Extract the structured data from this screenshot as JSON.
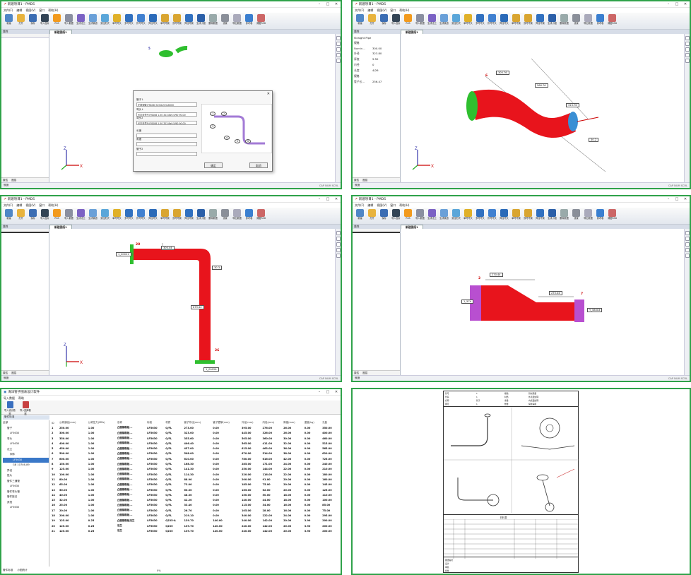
{
  "app": {
    "title": "新建项目1 - PMDS",
    "menu": [
      "文件(F)",
      "编辑",
      "视图(V)",
      "窗口",
      "帮助(H)"
    ],
    "ribbon": [
      {
        "label": "新建",
        "icon": "new-file-icon",
        "color": "#4f86c6"
      },
      {
        "label": "打开",
        "icon": "folder-icon",
        "color": "#e8b33d"
      },
      {
        "label": "保存",
        "icon": "save-icon",
        "color": "#3b6db3"
      },
      {
        "label": "导入图片",
        "icon": "monitor-icon",
        "color": "#345"
      },
      {
        "label": "RSS",
        "icon": "rss-icon",
        "color": "#f29a1d"
      },
      {
        "label": "导入数据",
        "icon": "data-icon",
        "color": "#8a8fa0"
      },
      {
        "label": "生成法兰",
        "icon": "flange-icon",
        "color": "#7b62c4"
      },
      {
        "label": "生成管道",
        "icon": "pipe-icon",
        "color": "#6aa0d8"
      },
      {
        "label": "变径形式",
        "icon": "reducer-icon",
        "color": "#5aa6d9"
      },
      {
        "label": "单弯弯头",
        "icon": "elbow-icon",
        "color": "#e0b028"
      },
      {
        "label": "多弯弯头",
        "icon": "multi-elbow-icon",
        "color": "#3070c0"
      },
      {
        "label": "折弯弯头",
        "icon": "bend-icon",
        "color": "#4080d0"
      },
      {
        "label": "异径弯头",
        "icon": "reduce-elbow-icon",
        "color": "#2a6ab8"
      },
      {
        "label": "单弯弯管",
        "icon": "single-bend-icon",
        "color": "#d9a530"
      },
      {
        "label": "双弯弯管",
        "icon": "double-bend-icon",
        "color": "#d9a530"
      },
      {
        "label": "异径弯管",
        "icon": "reduce-bend-icon",
        "color": "#3070c0"
      },
      {
        "label": "生成小图",
        "icon": "cad-icon",
        "color": "#2b5fa8"
      },
      {
        "label": "删除数据",
        "icon": "delete-icon",
        "color": "#9aa"
      },
      {
        "label": "设置",
        "icon": "tools-icon",
        "color": "#8a8f99"
      },
      {
        "label": "导出数据",
        "icon": "export-icon",
        "color": "#aab"
      },
      {
        "label": "参考卷",
        "icon": "brush-icon",
        "color": "#3a7fd0"
      },
      {
        "label": "调图RSD",
        "icon": "pen-icon",
        "color": "#c66"
      }
    ],
    "side_header": "属性",
    "doc_tab": "新建图纸1",
    "side_tabs": [
      "属性",
      "图层"
    ],
    "status_left": "就绪",
    "status_right": "CAP NUM SCRL",
    "colors": {
      "pipe": "#e8141c",
      "flange_green": "#2fbf2f",
      "flange_purple": "#b84fd0",
      "accent": "#2fa24a"
    }
  },
  "p1": {
    "dialog": {
      "field1_label": "管子↓",
      "field1_value": "无缝钢管(FSK08 323.8x9.5x6000",
      "field2_label": "弯头↓",
      "field2_value": "长半径弯头(FSK08 1.50 323.8x9.5/90 90.00",
      "field3_label": "弯头2",
      "field3_value": "长半径弯头(FSK08 1.50 323.8x9.5/90 90.00",
      "field4_label": "长度",
      "field5_label": "角度",
      "field6_label": "管子2",
      "nodes": [
        "1",
        "2",
        "3",
        "4",
        "5",
        "6"
      ],
      "ok": "确定",
      "cancel": "取消"
    },
    "markers": [
      "5",
      "9"
    ]
  },
  "p2": {
    "prop_title": "Straight Pipe",
    "group1": "规格",
    "rows": [
      {
        "k": "Nomin...",
        "v": "300.00"
      },
      {
        "k": "外径",
        "v": "323.80"
      },
      {
        "k": "厚度",
        "v": "9.50"
      },
      {
        "k": "内径",
        "v": "0"
      },
      {
        "k": "长度",
        "v": "4/26"
      }
    ],
    "group2": "规格",
    "row_last": {
      "k": "管子长...",
      "v": "256.47"
    },
    "labels": [
      "300.76",
      "566.76",
      "313.76",
      "30.2"
    ],
    "marker": "6"
  },
  "p3": {
    "labels": [
      "1_00021",
      "300.44",
      "30.3",
      "679.44",
      "1_00026"
    ],
    "markers": [
      "28",
      "26"
    ]
  },
  "p4": {
    "labels": [
      "270.44",
      "270.44",
      "1_5Ch",
      "Y_58003"
    ],
    "markers": [
      "2",
      "7"
    ]
  },
  "p5": {
    "title": "海洋管子图表设计软件",
    "menu": [
      "导入数据",
      "帮助"
    ],
    "buttons": [
      "导入设计数据",
      "导入图库数据"
    ],
    "tree_header": "管件标准",
    "tree": [
      "全部",
      "管子",
      "LF5630",
      "弯头",
      "LF5630",
      "法兰",
      "阀件",
      "LF5630",
      "GB 10746-89",
      "异径",
      "垫片",
      "管件三通管",
      "LF5630",
      "管件弯头管",
      "管件接法",
      "其他",
      "LF5630"
    ],
    "bottom_tabs": [
      "管件标准",
      "小图统计"
    ],
    "status": "0%",
    "columns": [
      "ID",
      "公称通径(mm)",
      "公称压力(MPa)",
      "名称",
      "标准",
      "材质",
      "管子外径(mm)",
      "管子壁厚(mm)",
      "外径(mm)",
      "内径(mm)",
      "厚度(mm)",
      "重量(kg)",
      "孔距"
    ],
    "rows": [
      [
        "1",
        "250.00",
        "1.00",
        "凸面钢制板...",
        "LF5630",
        "Q/FL",
        "273.00",
        "0.00",
        "395.00",
        "276.00",
        "26.00",
        "0.00",
        "350.00"
      ],
      [
        "2",
        "300.00",
        "1.00",
        "凸面钢制板...",
        "LF5630",
        "Q/FL",
        "323.00",
        "0.00",
        "445.00",
        "326.00",
        "26.00",
        "0.00",
        "400.00"
      ],
      [
        "3",
        "350.00",
        "1.00",
        "凸面钢制板...",
        "LF5630",
        "Q/FL",
        "355.60",
        "0.00",
        "505.00",
        "360.00",
        "30.00",
        "0.00",
        "460.00"
      ],
      [
        "4",
        "400.00",
        "1.00",
        "凸面钢制板...",
        "LF5630",
        "Q/FL",
        "406.40",
        "0.00",
        "565.00",
        "411.00",
        "32.00",
        "0.00",
        "515.00"
      ],
      [
        "5",
        "450.00",
        "1.00",
        "凸面钢制板...",
        "LF5630",
        "Q/FL",
        "457.00",
        "0.00",
        "615.00",
        "463.00",
        "36.00",
        "0.00",
        "565.00"
      ],
      [
        "6",
        "500.00",
        "1.00",
        "凸面钢制板...",
        "LF5630",
        "Q/FL",
        "508.00",
        "0.00",
        "670.00",
        "514.00",
        "38.00",
        "0.00",
        "620.00"
      ],
      [
        "7",
        "600.00",
        "1.00",
        "凸面钢制板...",
        "LF5630",
        "Q/FL",
        "610.00",
        "0.00",
        "780.00",
        "616.00",
        "42.00",
        "0.00",
        "725.00"
      ],
      [
        "8",
        "150.00",
        "1.00",
        "凸面钢制板...",
        "LF5630",
        "Q/FL",
        "168.30",
        "0.00",
        "285.00",
        "171.00",
        "24.00",
        "0.00",
        "240.00"
      ],
      [
        "9",
        "125.00",
        "1.00",
        "凸面钢制板...",
        "LF5630",
        "Q/FL",
        "141.30",
        "0.00",
        "250.00",
        "144.00",
        "22.00",
        "0.00",
        "210.00"
      ],
      [
        "10",
        "100.00",
        "1.00",
        "凸面钢制板...",
        "LF5630",
        "Q/FL",
        "114.30",
        "0.00",
        "220.00",
        "116.00",
        "22.00",
        "0.00",
        "180.00"
      ],
      [
        "11",
        "80.00",
        "1.00",
        "凸面钢制板...",
        "LF5630",
        "Q/FL",
        "88.90",
        "0.00",
        "200.00",
        "91.00",
        "20.00",
        "0.00",
        "160.00"
      ],
      [
        "12",
        "65.00",
        "1.00",
        "凸面钢制板...",
        "LF5630",
        "Q/FL",
        "73.00",
        "0.00",
        "185.00",
        "75.00",
        "20.00",
        "0.00",
        "145.00"
      ],
      [
        "13",
        "50.00",
        "1.00",
        "凸面钢制板...",
        "LF5630",
        "Q/FL",
        "60.30",
        "0.00",
        "165.00",
        "62.00",
        "20.00",
        "0.00",
        "125.00"
      ],
      [
        "14",
        "40.00",
        "1.00",
        "凸面钢制板...",
        "LF5630",
        "Q/FL",
        "48.30",
        "0.00",
        "150.00",
        "50.00",
        "18.00",
        "0.00",
        "110.00"
      ],
      [
        "15",
        "32.00",
        "1.00",
        "凸面钢制板...",
        "LF5630",
        "Q/FL",
        "42.20",
        "0.00",
        "140.00",
        "44.00",
        "18.00",
        "0.00",
        "100.00"
      ],
      [
        "16",
        "25.00",
        "1.00",
        "凸面钢制板...",
        "LF5630",
        "Q/FL",
        "33.40",
        "0.00",
        "115.00",
        "34.00",
        "16.00",
        "0.00",
        "85.00"
      ],
      [
        "17",
        "20.00",
        "1.00",
        "凸面钢制板...",
        "LF5630",
        "Q/FL",
        "26.70",
        "0.00",
        "105.00",
        "28.00",
        "16.00",
        "0.00",
        "75.00"
      ],
      [
        "18",
        "200.00",
        "1.00",
        "凸面钢制板...",
        "LF5630",
        "Q/FL",
        "219.10",
        "0.00",
        "340.00",
        "222.00",
        "24.00",
        "0.00",
        "295.00"
      ],
      [
        "19",
        "125.00",
        "0.25",
        "凸面钢制板法兰",
        "LF5630",
        "Q235-A",
        "139.70",
        "140.00",
        "240.00",
        "142.00",
        "20.00",
        "3.90",
        "200.00"
      ],
      [
        "20",
        "125.00",
        "0.25",
        "法兰",
        "LF5630",
        "Q235",
        "139.70",
        "140.00",
        "240.00",
        "142.00",
        "20.00",
        "3.90",
        "200.00"
      ],
      [
        "21",
        "125.00",
        "0.25",
        "法兰",
        "LF5630",
        "Q235",
        "139.70",
        "140.00",
        "240.00",
        "142.00",
        "20.00",
        "3.90",
        "200.00"
      ]
    ]
  },
  "p6": {
    "header_rows": [
      [
        "管号",
        "1",
        "规格",
        "管材质量"
      ],
      [
        "管系",
        "1",
        "材质",
        "外表面处理"
      ],
      [
        "名称",
        "管子",
        "重量",
        "内表面处理"
      ],
      [
        "图号",
        "1",
        "数量",
        "焊缝等级"
      ]
    ],
    "table_title": "材料表",
    "footer": [
      "图纸编号",
      "设计",
      "审核",
      "批准"
    ]
  }
}
